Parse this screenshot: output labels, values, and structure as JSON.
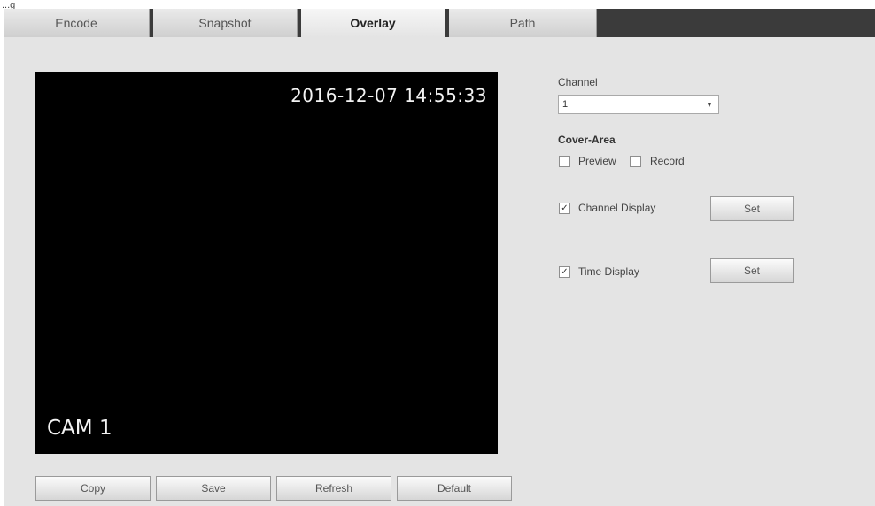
{
  "window": {
    "title_fragment": "...g"
  },
  "tabs": [
    {
      "label": "Encode",
      "selected": false
    },
    {
      "label": "Snapshot",
      "selected": false
    },
    {
      "label": "Overlay",
      "selected": true
    },
    {
      "label": "Path",
      "selected": false
    }
  ],
  "preview": {
    "timestamp": "2016-12-07 14:55:33",
    "channel_label": "CAM 1"
  },
  "bottom_buttons": {
    "copy": "Copy",
    "save": "Save",
    "refresh": "Refresh",
    "default": "Default"
  },
  "settings": {
    "channel_label": "Channel",
    "channel_value": "1",
    "cover_area_label": "Cover-Area",
    "preview_label": "Preview",
    "preview_checked": false,
    "record_label": "Record",
    "record_checked": false,
    "channel_display_label": "Channel Display",
    "channel_display_checked": true,
    "time_display_label": "Time Display",
    "time_display_checked": true,
    "set_label": "Set",
    "check_glyph": "✓"
  },
  "icons": {
    "dropdown": "chevron-down-icon"
  }
}
